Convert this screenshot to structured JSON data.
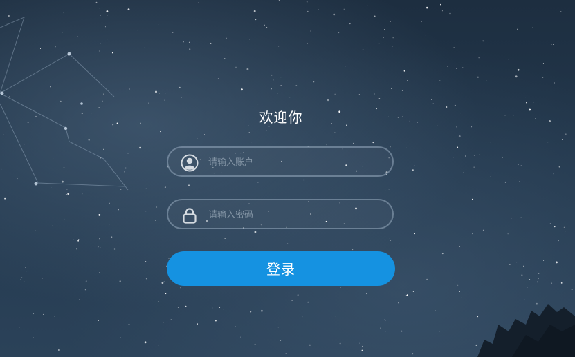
{
  "login": {
    "title": "欢迎你",
    "username": {
      "placeholder": "请输入账户",
      "value": "",
      "icon": "user-icon"
    },
    "password": {
      "placeholder": "请输入密码",
      "value": "",
      "icon": "lock-icon"
    },
    "submit_label": "登录"
  },
  "colors": {
    "accent": "#1592e1",
    "background": "#23384d"
  }
}
